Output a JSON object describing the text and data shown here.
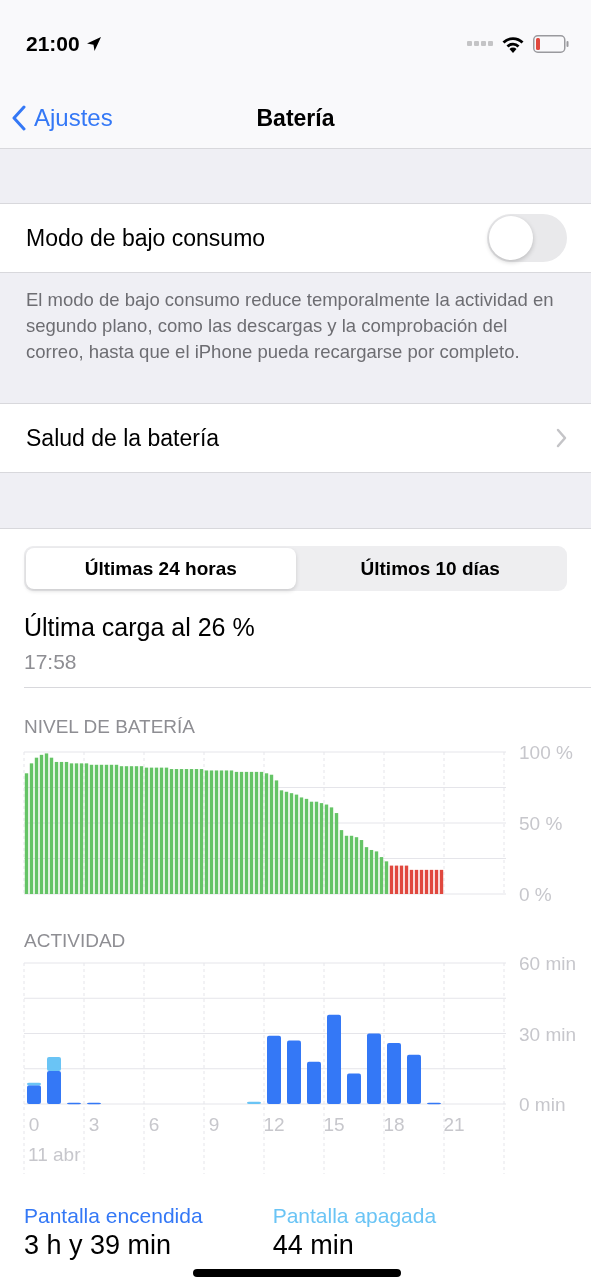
{
  "status_bar": {
    "time": "21:00"
  },
  "nav": {
    "back": "Ajustes",
    "title": "Batería"
  },
  "low_power": {
    "label": "Modo de bajo consumo",
    "on": false,
    "footnote": "El modo de bajo consumo reduce temporalmente la actividad en segundo plano, como las descargas y la comprobación del correo, hasta que el iPhone pueda recargarse por completo."
  },
  "battery_health": {
    "label": "Salud de la batería"
  },
  "segments": [
    {
      "label": "Últimas 24 horas",
      "selected": true
    },
    {
      "label": "Últimos 10 días",
      "selected": false
    }
  ],
  "last_charge": {
    "title": "Última carga al 26 %",
    "time": "17:58"
  },
  "battery_level": {
    "title": "NIVEL DE BATERÍA",
    "chart_data": {
      "type": "bar",
      "categories": [
        null,
        null,
        null,
        null,
        null,
        null,
        null,
        null,
        null,
        null,
        null,
        null,
        null,
        null,
        null,
        null,
        null,
        null,
        null,
        null,
        null,
        null,
        null,
        null,
        null,
        null,
        null,
        null,
        null,
        null,
        null,
        null,
        null,
        null,
        null,
        null,
        null,
        null,
        null,
        null,
        null,
        null,
        null,
        null,
        null,
        null,
        null,
        null,
        null,
        null,
        null,
        null,
        null,
        null,
        null,
        null,
        null,
        null,
        null,
        null,
        null,
        null,
        null,
        null,
        null,
        null,
        null,
        null,
        null,
        null,
        null,
        null,
        null,
        null,
        null,
        null,
        null,
        null,
        null,
        null,
        null,
        null,
        null,
        null,
        null,
        null,
        null,
        null,
        null,
        null,
        null,
        null,
        null,
        null,
        null,
        null
      ],
      "ylim": [
        0,
        100
      ],
      "yticks": [
        {
          "value": 0,
          "label": "0 %"
        },
        {
          "value": 50,
          "label": "50 %"
        },
        {
          "value": 100,
          "label": "100 %"
        }
      ],
      "series": [
        {
          "color": "#65c466",
          "values": [
            85,
            92,
            96,
            98,
            99,
            96,
            93,
            93,
            93,
            92,
            92,
            92,
            92,
            91,
            91,
            91,
            91,
            91,
            91,
            90,
            90,
            90,
            90,
            90,
            89,
            89,
            89,
            89,
            89,
            88,
            88,
            88,
            88,
            88,
            88,
            88,
            87,
            87,
            87,
            87,
            87,
            87,
            86,
            86,
            86,
            86,
            86,
            86,
            85,
            84,
            80,
            73,
            72,
            71,
            70,
            68,
            67,
            65,
            65,
            64,
            63,
            61,
            57,
            45,
            41,
            41,
            40,
            38,
            33,
            31,
            30,
            26,
            23,
            null,
            null,
            null,
            null,
            null,
            null,
            null,
            null,
            null,
            null,
            null,
            null,
            null,
            null,
            null,
            null,
            null,
            null,
            null,
            null,
            null,
            null,
            null
          ]
        },
        {
          "color": "#e0483e",
          "values": [
            null,
            null,
            null,
            null,
            null,
            null,
            null,
            null,
            null,
            null,
            null,
            null,
            null,
            null,
            null,
            null,
            null,
            null,
            null,
            null,
            null,
            null,
            null,
            null,
            null,
            null,
            null,
            null,
            null,
            null,
            null,
            null,
            null,
            null,
            null,
            null,
            null,
            null,
            null,
            null,
            null,
            null,
            null,
            null,
            null,
            null,
            null,
            null,
            null,
            null,
            null,
            null,
            null,
            null,
            null,
            null,
            null,
            null,
            null,
            null,
            null,
            null,
            null,
            null,
            null,
            null,
            null,
            null,
            null,
            null,
            null,
            null,
            null,
            20,
            20,
            20,
            20,
            17,
            17,
            17,
            17,
            17,
            17,
            17,
            null,
            null,
            null,
            null,
            null,
            null,
            null,
            null,
            null,
            null,
            null,
            null
          ]
        }
      ]
    }
  },
  "activity": {
    "title": "ACTIVIDAD",
    "date_label": "11 abr",
    "chart_data": {
      "type": "bar",
      "stacked": true,
      "x": [
        0,
        1,
        2,
        3,
        4,
        5,
        6,
        7,
        8,
        9,
        10,
        11,
        12,
        13,
        14,
        15,
        16,
        17,
        18,
        19,
        20
      ],
      "xlim": [
        -0.5,
        23.5
      ],
      "ylim": [
        0,
        60
      ],
      "yticks": [
        {
          "value": 0,
          "label": "0 min"
        },
        {
          "value": 30,
          "label": "30 min"
        },
        {
          "value": 60,
          "label": "60 min"
        }
      ],
      "xticks": [
        {
          "value": 0,
          "label": "0"
        },
        {
          "value": 3,
          "label": "3"
        },
        {
          "value": 6,
          "label": "6"
        },
        {
          "value": 9,
          "label": "9"
        },
        {
          "value": 12,
          "label": "12"
        },
        {
          "value": 15,
          "label": "15"
        },
        {
          "value": 18,
          "label": "18"
        },
        {
          "value": 21,
          "label": "21"
        }
      ],
      "series": [
        {
          "name": "Pantalla encendida",
          "color": "#3478f6",
          "values": [
            8,
            14,
            0.5,
            0.5,
            null,
            null,
            null,
            null,
            null,
            null,
            null,
            null,
            29,
            27,
            18,
            38,
            13,
            30,
            26,
            21,
            0.5
          ]
        },
        {
          "name": "Pantalla apagada",
          "color": "#6ac4f5",
          "values": [
            1,
            6,
            null,
            null,
            null,
            null,
            null,
            null,
            null,
            null,
            null,
            1,
            null,
            null,
            null,
            null,
            null,
            null,
            null,
            null,
            null
          ]
        }
      ]
    }
  },
  "legend_values": [
    "3 h y 39 min",
    "44 min"
  ]
}
